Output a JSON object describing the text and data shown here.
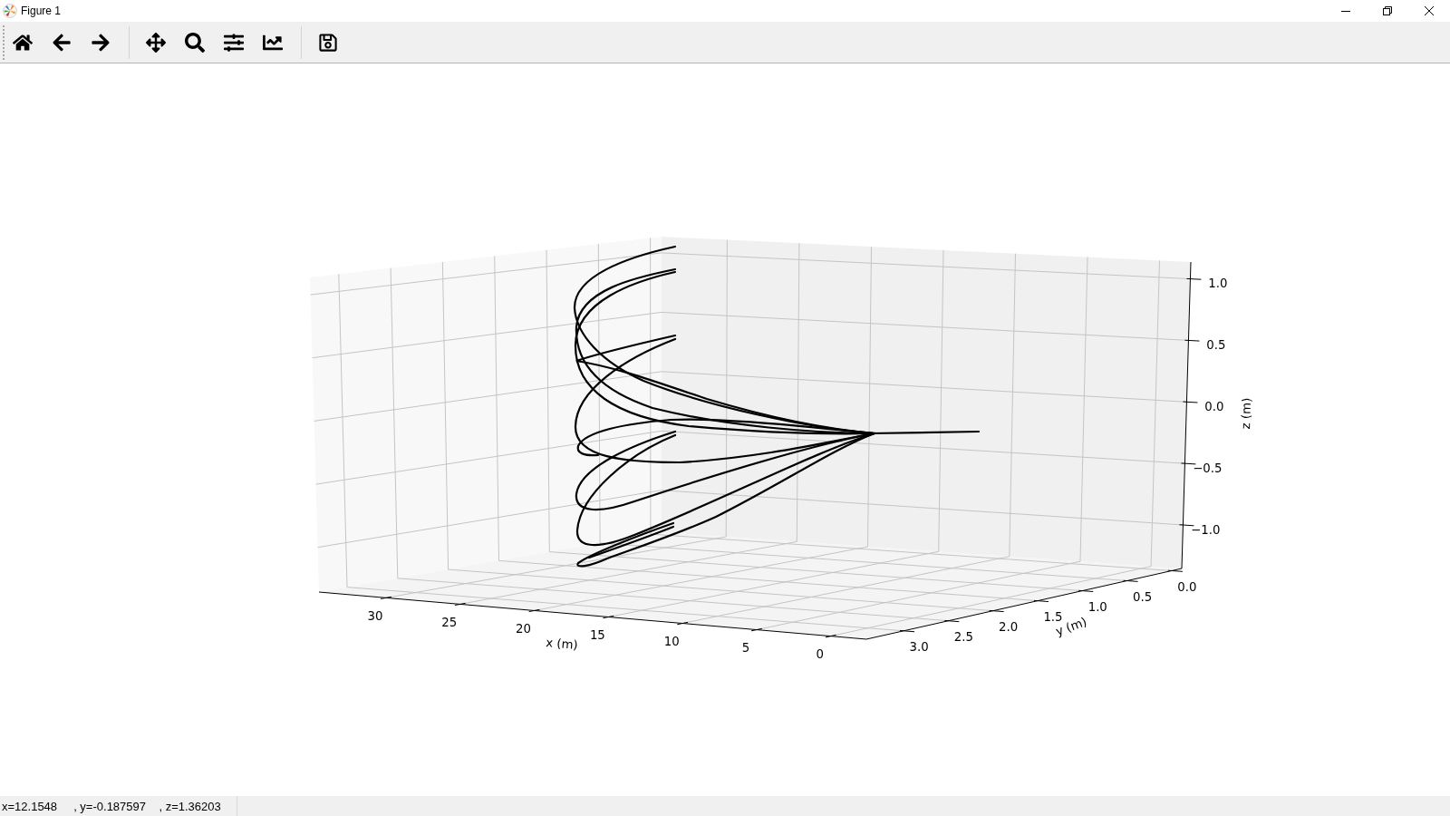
{
  "window": {
    "title": "Figure 1"
  },
  "toolbar": {
    "groups": [
      {
        "buttons": [
          {
            "kind": "home"
          },
          {
            "kind": "back"
          },
          {
            "kind": "forward"
          }
        ]
      },
      {
        "buttons": [
          {
            "kind": "pan"
          },
          {
            "kind": "zoom"
          },
          {
            "kind": "subplots"
          },
          {
            "kind": "customize"
          }
        ]
      },
      {
        "buttons": [
          {
            "kind": "save"
          }
        ]
      }
    ]
  },
  "figure": {
    "axes": {
      "xlabel": "x (m)",
      "xticks": [
        "30",
        "25",
        "20",
        "15",
        "10",
        "5",
        "0"
      ],
      "ylabel": "y (m)",
      "yticks": [
        "3.0",
        "2.5",
        "2.0",
        "1.5",
        "1.0",
        "0.5",
        "0.0"
      ],
      "zlabel": "z (m)",
      "zticks": [
        "1.0",
        "0.5",
        "0.0",
        "−0.5",
        "−1.0"
      ]
    }
  },
  "status_bar": {
    "text": "x=12.1548     , y=-0.187597    , z=1.36203"
  }
}
